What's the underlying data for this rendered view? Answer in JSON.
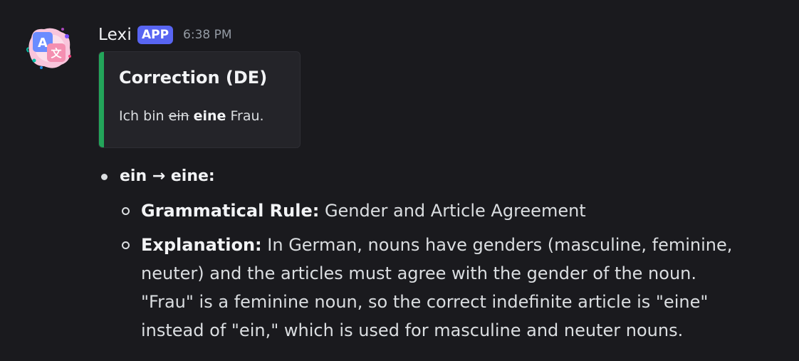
{
  "message": {
    "author": "Lexi",
    "badge": "APP",
    "timestamp": "6:38 PM",
    "avatar_icon": "translate-icon"
  },
  "embed": {
    "accent_color": "#23a55a",
    "title": "Correction (DE)",
    "text_before": "Ich bin ",
    "struck": "ein",
    "bold": "eine",
    "text_after": " Frau."
  },
  "explanation": {
    "change_title": "ein → eine:",
    "rule_label": "Grammatical Rule:",
    "rule_text": " Gender and Article Agreement",
    "explanation_label": "Explanation:",
    "explanation_text": " In German, nouns have genders (masculine, feminine, neuter) and the articles must agree with the gender of the noun. \"Frau\" is a feminine noun, so the correct indefinite article is \"eine\" instead of \"ein,\" which is used for masculine and neuter nouns."
  }
}
